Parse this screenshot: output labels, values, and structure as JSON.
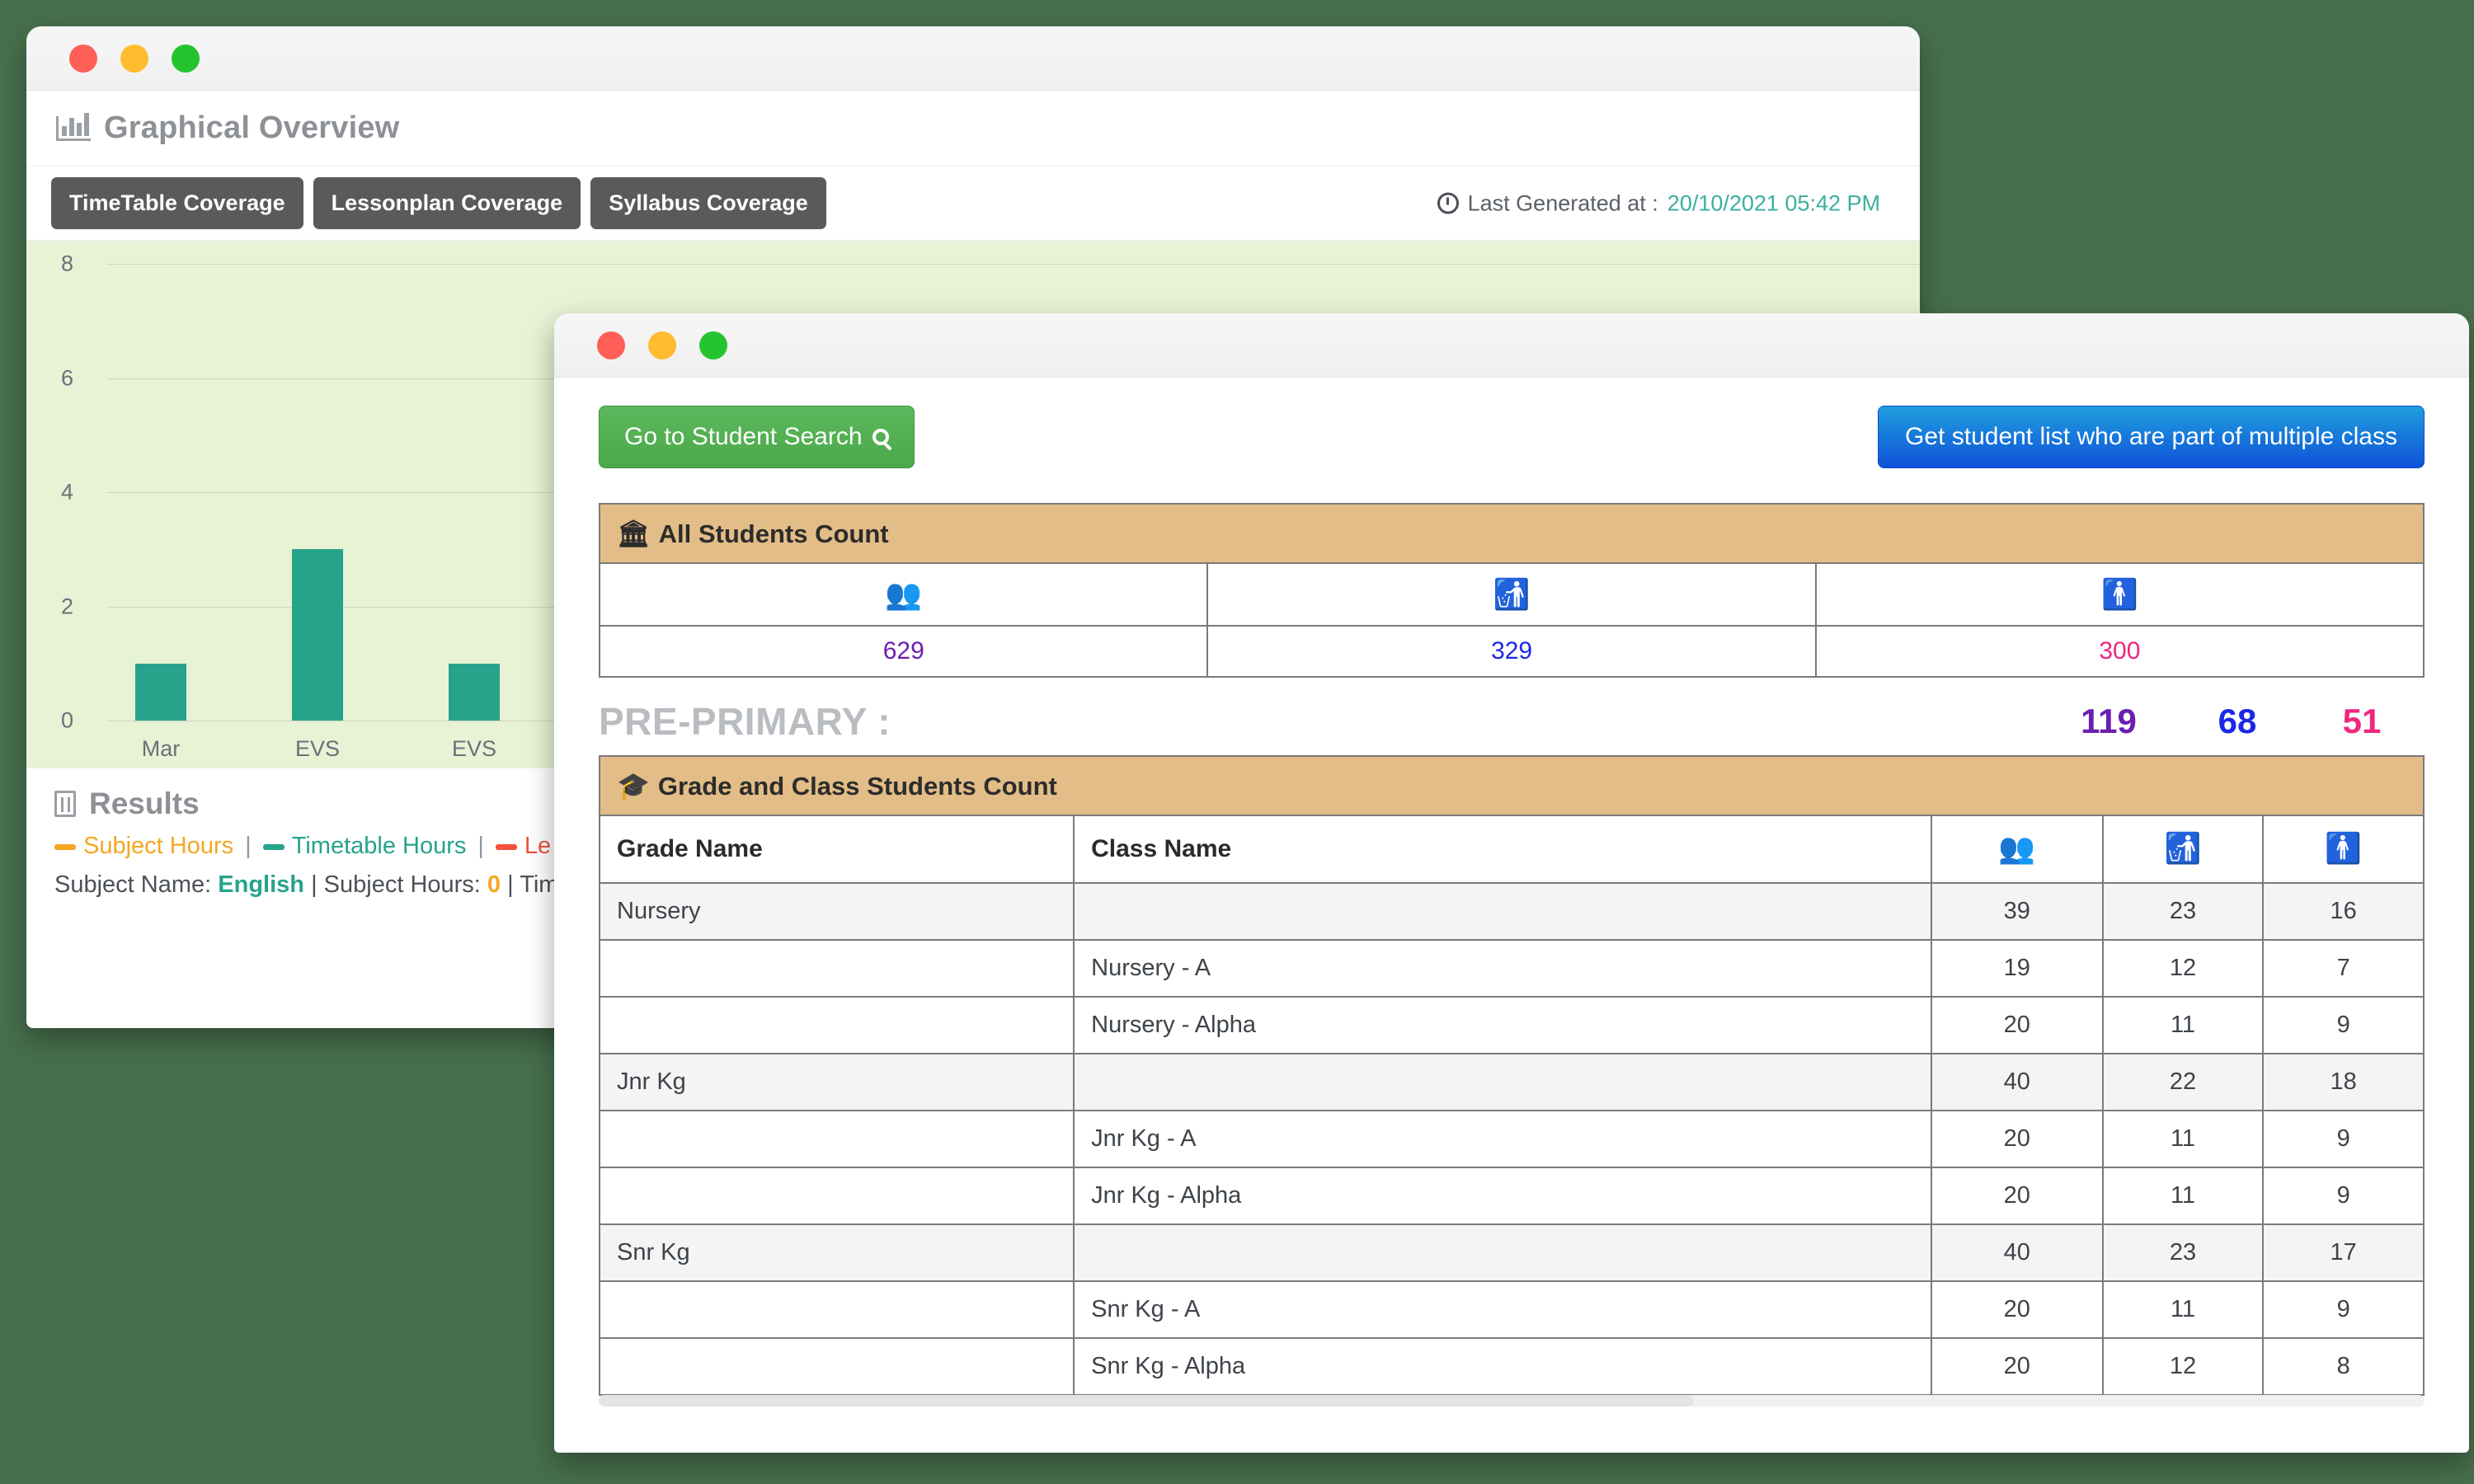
{
  "background_color": "#47704c",
  "chart_window": {
    "panel_title": "Graphical Overview",
    "panel_icon": "bar-chart-icon",
    "tabs": [
      {
        "label": "TimeTable Coverage",
        "active": true
      },
      {
        "label": "Lessonplan Coverage",
        "active": false
      },
      {
        "label": "Syllabus Coverage",
        "active": false
      }
    ],
    "last_generated": {
      "icon": "clock-icon",
      "label": "Last Generated at :",
      "value": "20/10/2021 05:42 PM",
      "value_color": "#3ab09e"
    },
    "results": {
      "icon": "document-icon",
      "title": "Results",
      "legend": [
        {
          "label": "Subject Hours",
          "color": "#f5a623"
        },
        {
          "label": "Timetable Hours",
          "color": "#27a38c"
        },
        {
          "label": "Le",
          "color": "#f4503c"
        }
      ],
      "summary_prefix": "Subject Name:",
      "summary_subject": "English",
      "summary_mid": "| Subject Hours:",
      "summary_hours": "0",
      "summary_suffix": "| Time"
    }
  },
  "chart_data": {
    "type": "bar",
    "title": "TimeTable Coverage",
    "categories": [
      "Mar",
      "EVS",
      "EVS"
    ],
    "values": [
      1,
      3,
      1
    ],
    "series": [
      {
        "name": "Timetable Hours",
        "values": [
          1,
          3,
          1
        ],
        "color": "#27a38c"
      }
    ],
    "xlabel": "",
    "ylabel": "",
    "ylim": [
      0,
      8
    ],
    "yticks": [
      0,
      2,
      4,
      6,
      8
    ],
    "grid": true,
    "plot_background": "#e8f2d5",
    "legend_position": "below",
    "legend_entries": [
      "Subject Hours",
      "Timetable Hours",
      "Le"
    ]
  },
  "students_window": {
    "buttons": {
      "student_search": {
        "label": "Go to Student Search",
        "icon": "search-icon",
        "color": "#4aa94a"
      },
      "multiple_class": {
        "label": "Get student list who are part of multiple class",
        "color": "#0f52d8"
      }
    },
    "all_students": {
      "header_icon": "bank-icon",
      "header": "All Students Count",
      "columns": [
        {
          "icon": "group-icon",
          "color": "#6b21a8"
        },
        {
          "icon": "male-icon",
          "color": "#1a28e8"
        },
        {
          "icon": "female-icon",
          "color": "#f0267e"
        }
      ],
      "values": [
        "629",
        "329",
        "300"
      ]
    },
    "section": {
      "title": "PRE-PRIMARY :",
      "total": "119",
      "male": "68",
      "female": "51"
    },
    "grade_table": {
      "header_icon": "graduation-cap-icon",
      "header": "Grade and Class Students Count",
      "columns": [
        "Grade Name",
        "Class Name",
        "group-icon",
        "male-icon",
        "female-icon"
      ],
      "rows": [
        {
          "type": "grade",
          "grade": "Nursery",
          "class": "",
          "total": "39",
          "male": "23",
          "female": "16"
        },
        {
          "type": "class",
          "grade": "",
          "class": "Nursery - A",
          "total": "19",
          "male": "12",
          "female": "7"
        },
        {
          "type": "class",
          "grade": "",
          "class": "Nursery - Alpha",
          "total": "20",
          "male": "11",
          "female": "9"
        },
        {
          "type": "grade",
          "grade": "Jnr Kg",
          "class": "",
          "total": "40",
          "male": "22",
          "female": "18"
        },
        {
          "type": "class",
          "grade": "",
          "class": "Jnr Kg - A",
          "total": "20",
          "male": "11",
          "female": "9"
        },
        {
          "type": "class",
          "grade": "",
          "class": "Jnr Kg - Alpha",
          "total": "20",
          "male": "11",
          "female": "9"
        },
        {
          "type": "grade",
          "grade": "Snr Kg",
          "class": "",
          "total": "40",
          "male": "23",
          "female": "17"
        },
        {
          "type": "class",
          "grade": "",
          "class": "Snr Kg - A",
          "total": "20",
          "male": "11",
          "female": "9"
        },
        {
          "type": "class",
          "grade": "",
          "class": "Snr Kg - Alpha",
          "total": "20",
          "male": "12",
          "female": "8"
        }
      ]
    }
  }
}
